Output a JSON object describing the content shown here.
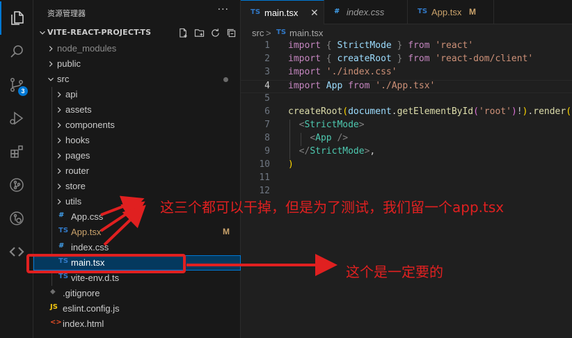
{
  "explorer": {
    "title": "资源管理器",
    "more": "···",
    "project": "VITE-REACT-PROJECT-TS",
    "items": [
      {
        "label": "node_modules",
        "kind": "folder"
      },
      {
        "label": "public",
        "kind": "folder"
      },
      {
        "label": "src",
        "kind": "folder-open"
      },
      {
        "label": "api",
        "kind": "folder"
      },
      {
        "label": "assets",
        "kind": "folder"
      },
      {
        "label": "components",
        "kind": "folder"
      },
      {
        "label": "hooks",
        "kind": "folder"
      },
      {
        "label": "pages",
        "kind": "folder"
      },
      {
        "label": "router",
        "kind": "folder"
      },
      {
        "label": "store",
        "kind": "folder"
      },
      {
        "label": "utils",
        "kind": "folder"
      },
      {
        "label": "App.css",
        "kind": "css",
        "icon": "#"
      },
      {
        "label": "App.tsx",
        "kind": "tsx",
        "icon": "TS",
        "status": "M"
      },
      {
        "label": "index.css",
        "kind": "css",
        "icon": "#"
      },
      {
        "label": "main.tsx",
        "kind": "tsx",
        "icon": "TS",
        "selected": true
      },
      {
        "label": "vite-env.d.ts",
        "kind": "ts",
        "icon": "TS"
      },
      {
        "label": ".gitignore",
        "kind": "git",
        "icon": "◆"
      },
      {
        "label": "eslint.config.js",
        "kind": "js",
        "icon": "JS"
      },
      {
        "label": "index.html",
        "kind": "html",
        "icon": "<>"
      }
    ]
  },
  "activity_badge": "3",
  "tabs": [
    {
      "label": "main.tsx",
      "icon": "TS",
      "active": true,
      "close": "✕"
    },
    {
      "label": "index.css",
      "icon": "#",
      "italic": true
    },
    {
      "label": "App.tsx",
      "icon": "TS",
      "status": "M"
    }
  ],
  "breadcrumb": {
    "folder": "src",
    "sep": ">",
    "icon": "TS",
    "file": "main.tsx"
  },
  "code": {
    "current_line": 4,
    "line_numbers": [
      "1",
      "2",
      "3",
      "4",
      "5",
      "6",
      "7",
      "8",
      "9",
      "10",
      "11",
      "12"
    ],
    "lines": [
      [
        [
          "kw",
          "import "
        ],
        [
          "pun",
          "{ "
        ],
        [
          "id",
          "StrictMode"
        ],
        [
          "pun",
          " } "
        ],
        [
          "kw",
          "from "
        ],
        [
          "str",
          "'react'"
        ]
      ],
      [
        [
          "kw",
          "import "
        ],
        [
          "pun",
          "{ "
        ],
        [
          "id",
          "createRoot"
        ],
        [
          "pun",
          " } "
        ],
        [
          "kw",
          "from "
        ],
        [
          "str",
          "'react-dom/client'"
        ]
      ],
      [
        [
          "kw",
          "import "
        ],
        [
          "str",
          "'./index.css'"
        ]
      ],
      [
        [
          "kw",
          "import "
        ],
        [
          "id",
          "App "
        ],
        [
          "kw",
          "from "
        ],
        [
          "str",
          "'./App.tsx'"
        ]
      ],
      [],
      [
        [
          "fn",
          "createRoot"
        ],
        [
          "br1",
          "("
        ],
        [
          "id",
          "document"
        ],
        [
          "plain",
          "."
        ],
        [
          "fn",
          "getElementById"
        ],
        [
          "br2",
          "("
        ],
        [
          "str",
          "'root'"
        ],
        [
          "br2",
          ")"
        ],
        [
          "plain",
          "!"
        ],
        [
          "br1",
          ")"
        ],
        [
          "plain",
          "."
        ],
        [
          "fn",
          "render"
        ],
        [
          "br1",
          "("
        ]
      ],
      [
        [
          "plain",
          "  "
        ],
        [
          "pun",
          "<"
        ],
        [
          "comp",
          "StrictMode"
        ],
        [
          "pun",
          ">"
        ]
      ],
      [
        [
          "plain",
          "    "
        ],
        [
          "pun",
          "<"
        ],
        [
          "comp",
          "App"
        ],
        [
          "pun",
          " />"
        ]
      ],
      [
        [
          "plain",
          "  "
        ],
        [
          "pun",
          "</"
        ],
        [
          "comp",
          "StrictMode"
        ],
        [
          "pun",
          ">"
        ],
        [
          "plain",
          ","
        ]
      ],
      [
        [
          "br1",
          ")"
        ]
      ],
      [],
      []
    ]
  },
  "annotations": {
    "remove_note": "这三个都可以干掉，但是为了测试，我们留一个app.tsx",
    "keep_note": "这个是一定要的"
  },
  "colors": {
    "accent": "#0078d4",
    "annotation": "#e02020",
    "ts_icon": "#3178c6",
    "css_icon": "#42a5f5",
    "js_icon": "#f1c40f",
    "html_icon": "#e44d26",
    "modified": "#c9a26b"
  }
}
